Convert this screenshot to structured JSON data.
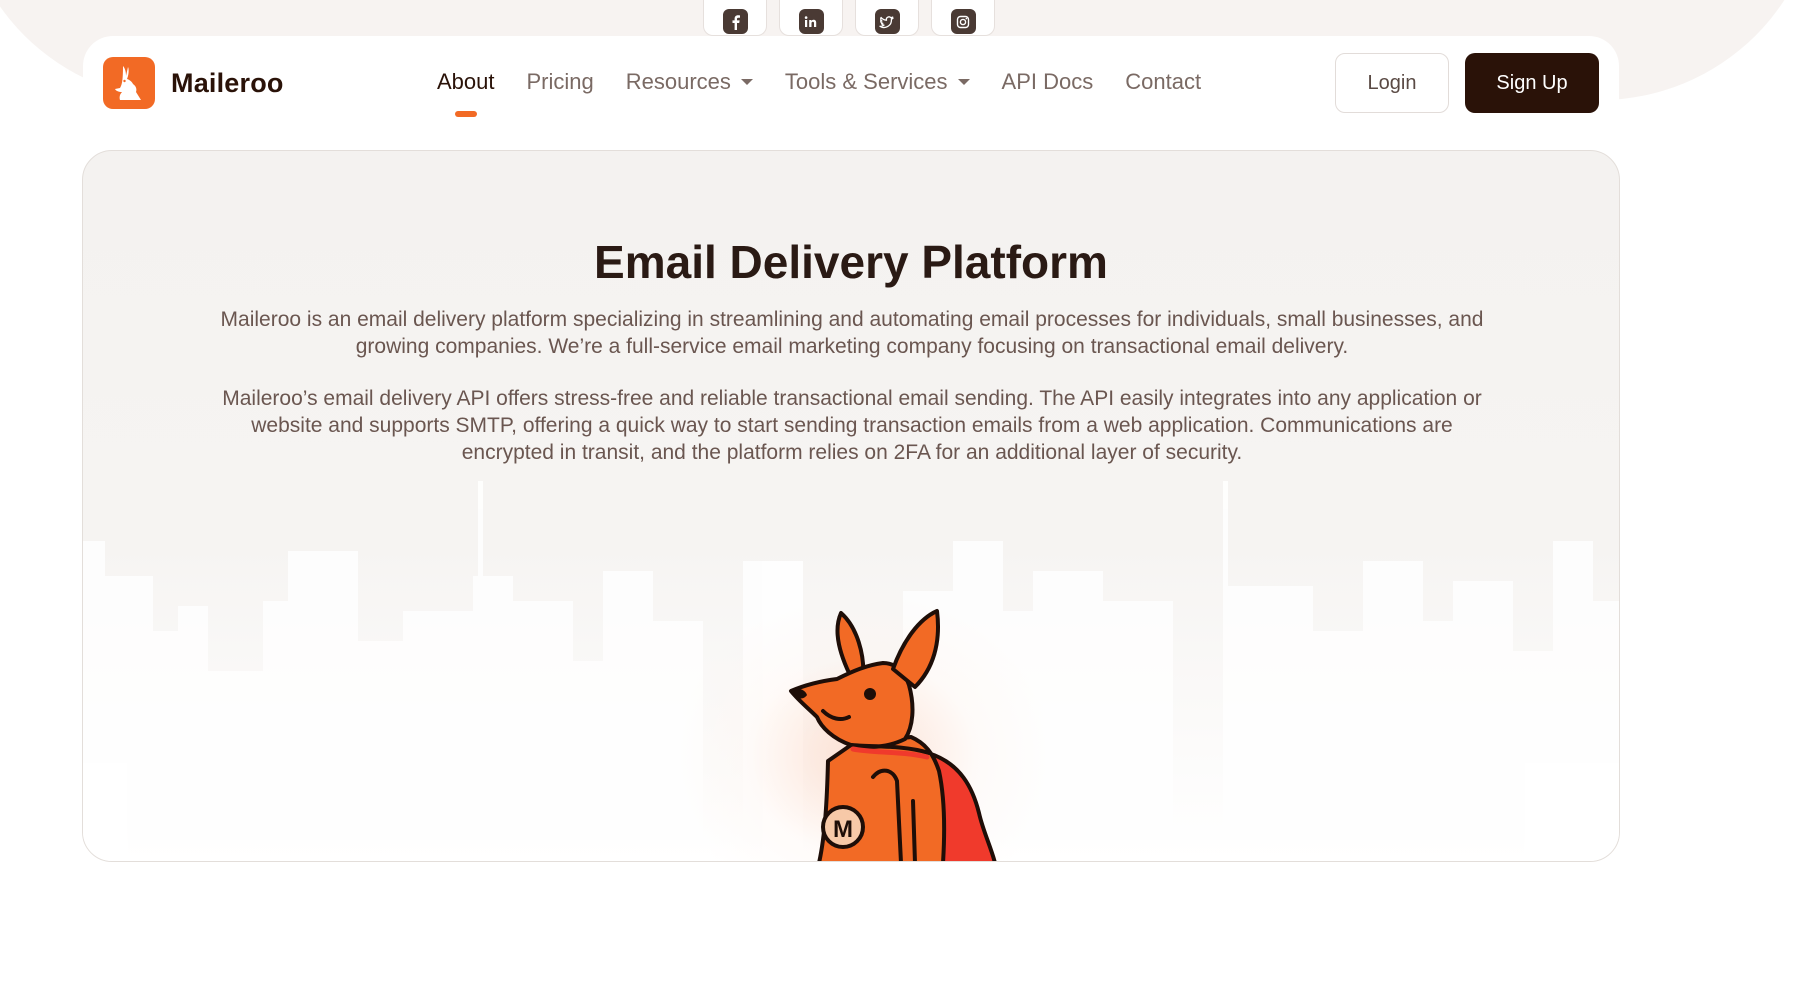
{
  "brand": {
    "name": "Maileroo",
    "accent_color": "#f26a25",
    "dark_color": "#2a1208"
  },
  "social": [
    {
      "icon": "facebook-icon"
    },
    {
      "icon": "linkedin-icon"
    },
    {
      "icon": "twitter-icon"
    },
    {
      "icon": "instagram-icon"
    }
  ],
  "nav": {
    "links": [
      {
        "label": "About",
        "active": true
      },
      {
        "label": "Pricing"
      },
      {
        "label": "Resources",
        "dropdown": true
      },
      {
        "label": "Tools & Services",
        "dropdown": true
      },
      {
        "label": "API Docs"
      },
      {
        "label": "Contact"
      }
    ],
    "login_label": "Login",
    "signup_label": "Sign Up"
  },
  "hero": {
    "title": "Email Delivery Platform",
    "paragraph1": "Maileroo is an email delivery platform specializing in streamlining and automating email processes for individuals, small businesses, and growing companies. We’re a full-service email marketing company focusing on transactional email delivery.",
    "paragraph2": "Maileroo’s email delivery API offers stress-free and reliable transactional email sending. The API easily integrates into any application or website and supports SMTP, offering a quick way to start sending transaction emails from a web application. Communications are encrypted in transit, and the platform relies on 2FA for an additional layer of security.",
    "mascot_badge_letter": "M"
  }
}
